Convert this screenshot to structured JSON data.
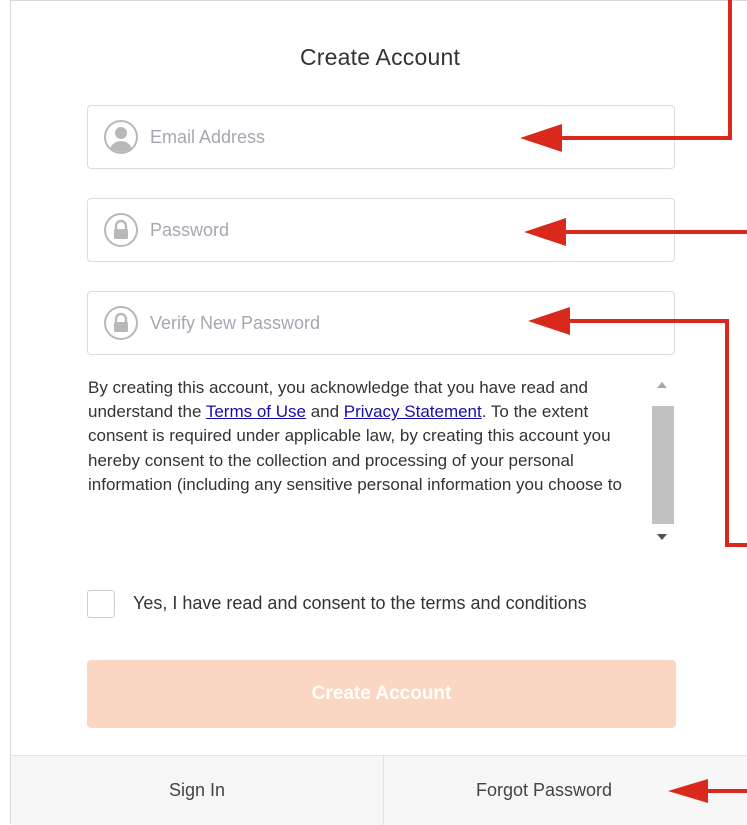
{
  "form": {
    "title": "Create Account",
    "email": {
      "placeholder": "Email Address",
      "icon": "user-icon"
    },
    "password": {
      "placeholder": "Password",
      "icon": "lock-icon"
    },
    "verify": {
      "placeholder": "Verify New Password",
      "icon": "lock-icon"
    },
    "terms": {
      "part1": "By creating this account, you acknowledge that you have read and understand the ",
      "terms_link": "Terms of Use",
      "and": " and ",
      "privacy_link": "Privacy Statement",
      "part2": ". To the extent consent is required under applicable law, by creating this account you hereby consent to the collection and processing of your personal information (including any sensitive personal information you choose to"
    },
    "consent_label": "Yes, I have read and consent to the terms and conditions",
    "submit_label": "Create Account"
  },
  "footer": {
    "sign_in": "Sign In",
    "forgot": "Forgot Password"
  },
  "colors": {
    "submit_bg": "#fbd6c2",
    "annotation_arrow": "#d9281c",
    "link": "#1a0dab"
  }
}
